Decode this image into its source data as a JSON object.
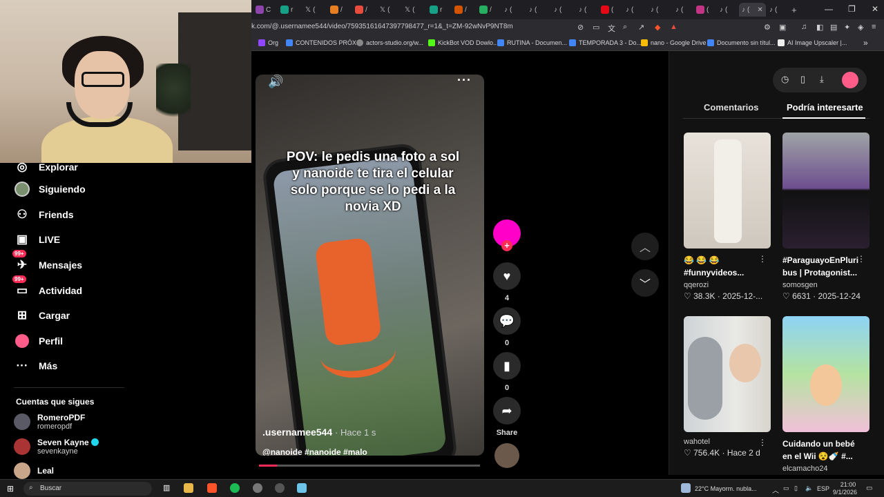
{
  "browser": {
    "url": "k.com/@.usernamee544/video/75935161647397798477_r=1&_t=ZM-92wNvP9NT8m",
    "bookmarks": [
      "Org",
      "CONTENIDOS PRÓX...",
      "actors-studio.org/w...",
      "KickBot VOD Dowlo...",
      "RUTINA - Documen...",
      "TEMPORADA 3 - Do...",
      "nano - Google Drive",
      "Documento sin títul...",
      "AI Image Upscaler |..."
    ],
    "more_bookmarks": "»",
    "new_tab": "+",
    "window": {
      "minimize": "—",
      "restore": "❐",
      "close": "✕"
    }
  },
  "nav": {
    "items": [
      {
        "label": "Explorar",
        "icon": "compass-icon"
      },
      {
        "label": "Siguiendo",
        "icon": "following-avatar-icon"
      },
      {
        "label": "Friends",
        "icon": "friends-icon"
      },
      {
        "label": "LIVE",
        "icon": "live-icon"
      },
      {
        "label": "Mensajes",
        "icon": "messages-icon",
        "badge": "99+"
      },
      {
        "label": "Actividad",
        "icon": "activity-icon",
        "badge": "99+"
      },
      {
        "label": "Cargar",
        "icon": "upload-icon"
      },
      {
        "label": "Perfil",
        "icon": "profile-icon"
      },
      {
        "label": "Más",
        "icon": "more-icon"
      }
    ],
    "following_title": "Cuentas que sigues",
    "following": [
      {
        "name": "RomeroPDF",
        "handle": "romeropdf"
      },
      {
        "name": "Seven Kayne",
        "handle": "sevenkayne",
        "verified": true
      },
      {
        "name": "Leal",
        "handle": ""
      }
    ]
  },
  "video": {
    "caption": "POV: le pedis una foto a sol y nanoide te tira el celular solo porque se lo pedi a la novia XD",
    "username": ".usernamee544",
    "time": "· Hace 1 s",
    "tags": "@nanoide #nanoide #malo",
    "progress_fraction": 0.08
  },
  "actions": {
    "likes": "4",
    "comments": "0",
    "saves": "0",
    "share": "Share"
  },
  "right_panel": {
    "tabs": [
      "Comentarios",
      "Podría interesarte"
    ],
    "active_tab": "Podría interesarte",
    "cards": [
      {
        "title": "😂 😂 😂 #funnyvideos...",
        "user": "qqerozi",
        "likes": "38.3K",
        "date": "2025-12-..."
      },
      {
        "title": "#ParaguayoEnPluri bus | Protagonist...",
        "user": "somosgen",
        "likes": "6631",
        "date": "2025-12-24"
      },
      {
        "title": "",
        "user": "wahotel",
        "likes": "756.4K",
        "date": "Hace 2 d"
      },
      {
        "title": "Cuidando un bebé en el Wii 😵🍼 #...",
        "user": "elcamacho24",
        "likes": "",
        "date": ""
      }
    ]
  },
  "taskbar": {
    "search": "Buscar",
    "weather": "22°C  Mayorm. nubla...",
    "lang": "ESP",
    "time": "21:00",
    "date": "9/1/2026"
  }
}
